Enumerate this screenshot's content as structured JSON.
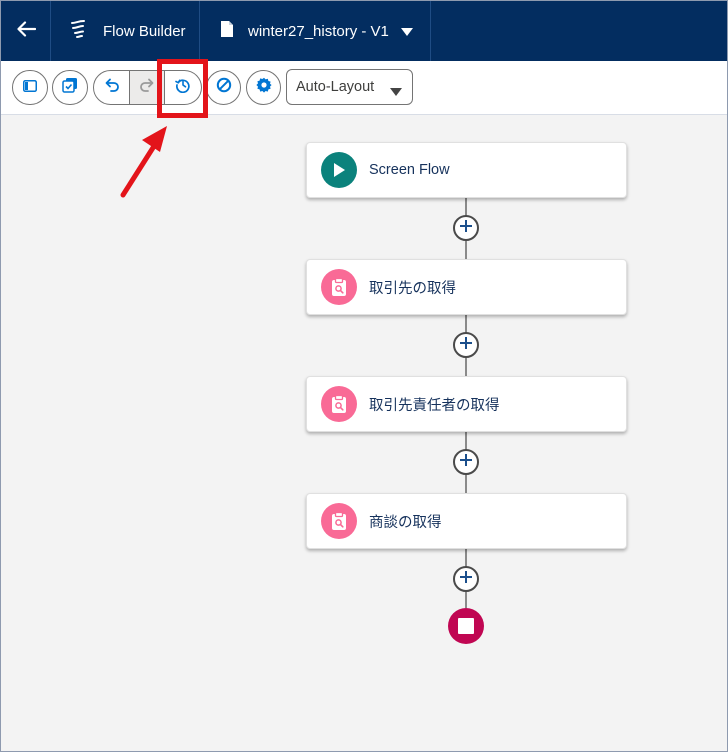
{
  "header": {
    "app_name": "Flow Builder",
    "file_name": "winter27_history - V1",
    "background": "#032d60"
  },
  "toolbar": {
    "buttons": [
      {
        "name": "toggle-panel",
        "icon": "panel-icon"
      },
      {
        "name": "copy",
        "icon": "copy-icon"
      },
      {
        "name": "undo",
        "icon": "undo-icon"
      },
      {
        "name": "redo",
        "icon": "redo-icon"
      },
      {
        "name": "version-history",
        "icon": "history-icon",
        "highlighted": true
      },
      {
        "name": "deactivate",
        "icon": "ban-icon"
      },
      {
        "name": "settings",
        "icon": "gear-icon"
      }
    ],
    "layout_select": {
      "value": "Auto-Layout"
    }
  },
  "canvas": {
    "nodes": [
      {
        "label": "Screen Flow",
        "icon": "play-icon",
        "color": "#0b827c"
      },
      {
        "label": "取引先の取得",
        "icon": "record-lookup-icon",
        "color": "#f96a96"
      },
      {
        "label": "取引先責任者の取得",
        "icon": "record-lookup-icon",
        "color": "#f96a96"
      },
      {
        "label": "商談の取得",
        "icon": "record-lookup-icon",
        "color": "#f96a96"
      }
    ],
    "end_node": {
      "icon": "stop-icon",
      "color": "#c00652"
    }
  },
  "annotation": {
    "highlight_color": "#e3141a",
    "arrow_color": "#e3141a"
  }
}
